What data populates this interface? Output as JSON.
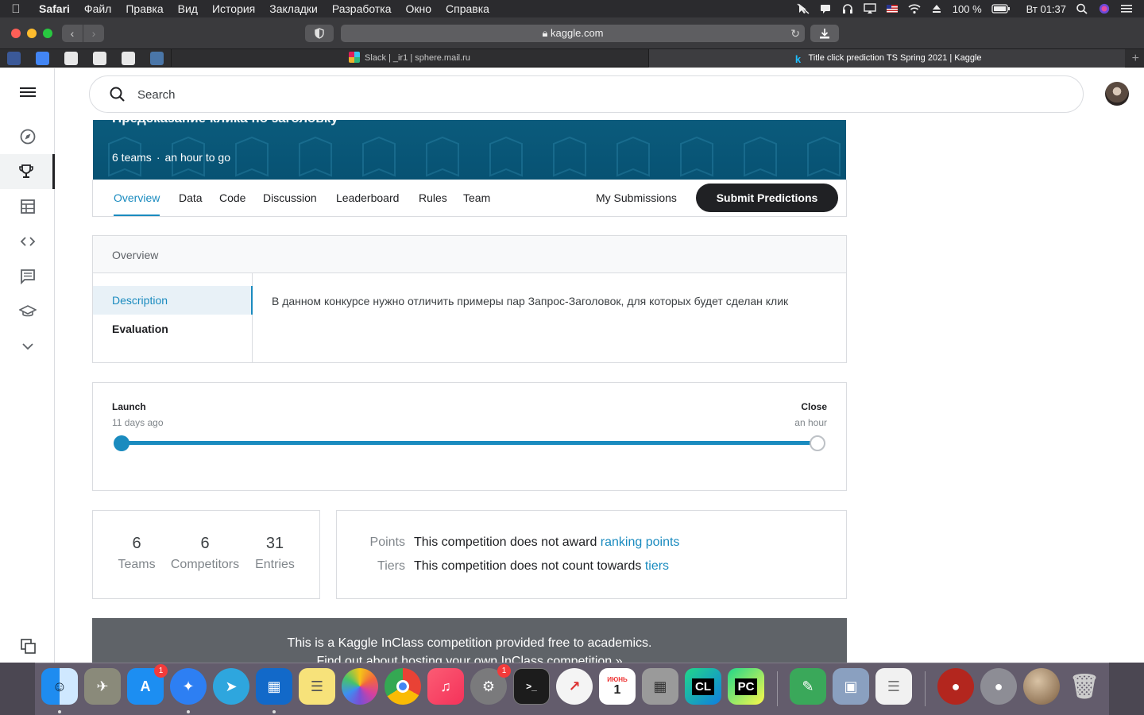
{
  "menubar": {
    "app": "Safari",
    "items": [
      "Файл",
      "Правка",
      "Вид",
      "История",
      "Закладки",
      "Разработка",
      "Окно",
      "Справка"
    ],
    "battery": "100 %",
    "clock": "Вт 01:37"
  },
  "browser": {
    "url": "kaggle.com",
    "tabs": [
      {
        "title": "Slack | _ir1 | sphere.mail.ru"
      },
      {
        "title": "Title click prediction TS Spring 2021 | Kaggle"
      }
    ]
  },
  "search": {
    "placeholder": "Search"
  },
  "competition": {
    "title": "Предсказание клика по заголовку",
    "teams_meta": "6 teams",
    "time_meta": "an hour to go",
    "separator": "·"
  },
  "tabs": {
    "items": [
      "Overview",
      "Data",
      "Code",
      "Discussion",
      "Leaderboard",
      "Rules",
      "Team"
    ],
    "my_submissions": "My Submissions",
    "submit": "Submit Predictions"
  },
  "overview": {
    "header": "Overview",
    "sections": [
      "Description",
      "Evaluation"
    ],
    "description": "В данном конкурсе нужно отличить примеры пар Запрос-Заголовок, для которых будет сделан клик"
  },
  "timeline": {
    "launch_label": "Launch",
    "launch_time": "11 days ago",
    "close_label": "Close",
    "close_time": "an hour",
    "progress": 1.0
  },
  "stats": [
    {
      "value": "6",
      "label": "Teams"
    },
    {
      "value": "6",
      "label": "Competitors"
    },
    {
      "value": "31",
      "label": "Entries"
    }
  ],
  "points": {
    "points_key": "Points",
    "points_text": "This competition does not award ",
    "points_link": "ranking points",
    "tiers_key": "Tiers",
    "tiers_text": "This competition does not count towards ",
    "tiers_link": "tiers"
  },
  "inclass": {
    "line1": "This is a Kaggle InClass competition provided free to academics.",
    "line2": "Find out about hosting your own InClass competition »"
  },
  "dock": {
    "appstore_badge": "1",
    "prefs_badge": "1",
    "calendar_month": "ИЮНЬ",
    "calendar_day": "1",
    "clion_label": "CL",
    "pycharm_label": "PC"
  },
  "colors": {
    "accent": "#1a8bbf",
    "banner": "#0b5b7c",
    "submit_bg": "#202124"
  }
}
